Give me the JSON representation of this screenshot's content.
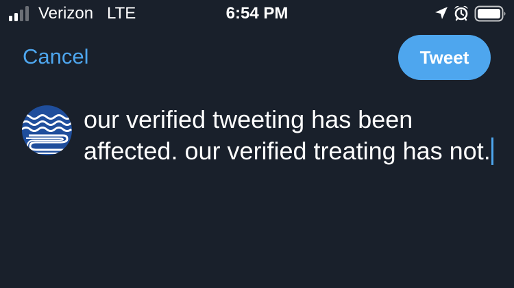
{
  "status_bar": {
    "carrier": "Verizon",
    "network": "LTE",
    "time": "6:54 PM",
    "icons": [
      "signal-bars-icon",
      "location-arrow-icon",
      "alarm-clock-icon",
      "battery-icon"
    ]
  },
  "nav": {
    "cancel_label": "Cancel",
    "tweet_label": "Tweet"
  },
  "composer": {
    "text": "our verified tweeting has been affected. our verified treating has not."
  },
  "colors": {
    "background": "#19202b",
    "accent": "#4ea6ee",
    "avatar_blue": "#1f4e9c",
    "text": "#ffffff"
  }
}
